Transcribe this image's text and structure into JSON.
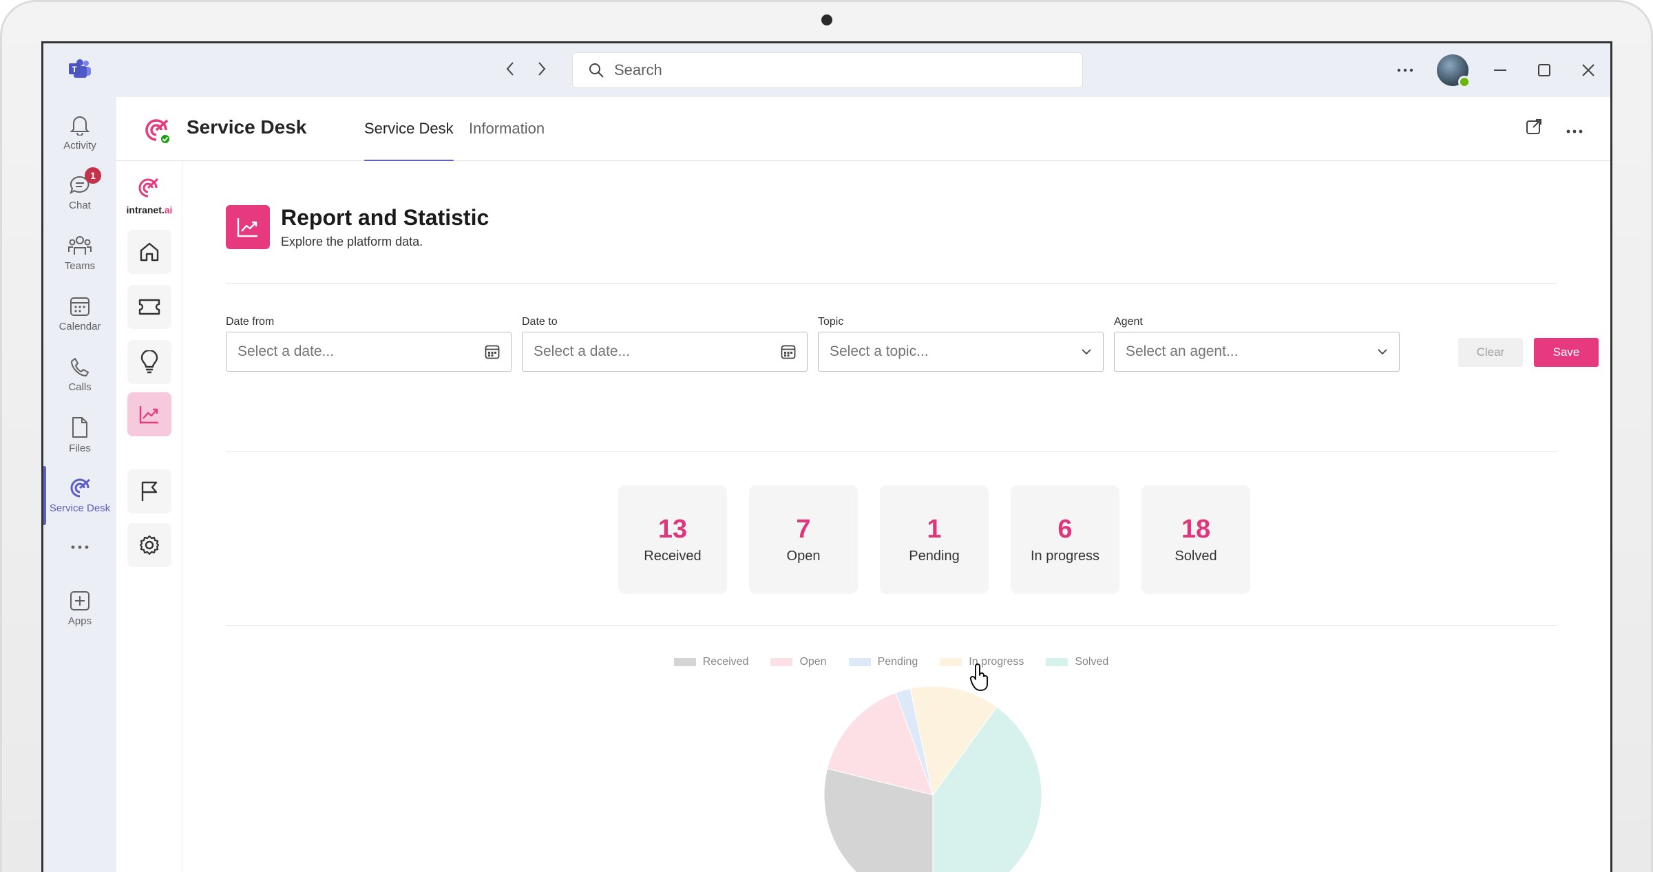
{
  "search": {
    "placeholder": "Search"
  },
  "rail": {
    "items": [
      {
        "label": "Activity"
      },
      {
        "label": "Chat",
        "badge": "1"
      },
      {
        "label": "Teams"
      },
      {
        "label": "Calendar"
      },
      {
        "label": "Calls"
      },
      {
        "label": "Files"
      },
      {
        "label": "Service Desk"
      },
      {
        "label": "Apps"
      }
    ]
  },
  "app": {
    "title": "Service Desk",
    "tabs": [
      {
        "label": "Service Desk"
      },
      {
        "label": "Information"
      }
    ]
  },
  "brand": {
    "name_prefix": "intranet.",
    "name_suffix": "ai"
  },
  "page": {
    "title": "Report and Statistic",
    "subtitle": "Explore the platform data."
  },
  "filters": {
    "date_from": {
      "label": "Date from",
      "placeholder": "Select a date..."
    },
    "date_to": {
      "label": "Date to",
      "placeholder": "Select a date..."
    },
    "topic": {
      "label": "Topic",
      "placeholder": "Select a topic..."
    },
    "agent": {
      "label": "Agent",
      "placeholder": "Select an agent..."
    },
    "clear_label": "Clear",
    "save_label": "Save"
  },
  "stats": [
    {
      "value": "13",
      "label": "Received"
    },
    {
      "value": "7",
      "label": "Open"
    },
    {
      "value": "1",
      "label": "Pending"
    },
    {
      "value": "6",
      "label": "In progress"
    },
    {
      "value": "18",
      "label": "Solved"
    }
  ],
  "colors": {
    "accent": "#e6397e",
    "teams_purple": "#5b5fc7"
  },
  "chart_data": {
    "type": "pie",
    "categories": [
      "Received",
      "Open",
      "Pending",
      "In progress",
      "Solved"
    ],
    "values": [
      13,
      7,
      1,
      6,
      18
    ],
    "colors": [
      "#d4d4d4",
      "#fde0e6",
      "#dde8f8",
      "#fdf2dd",
      "#d7f2ec"
    ],
    "legend": "top"
  }
}
